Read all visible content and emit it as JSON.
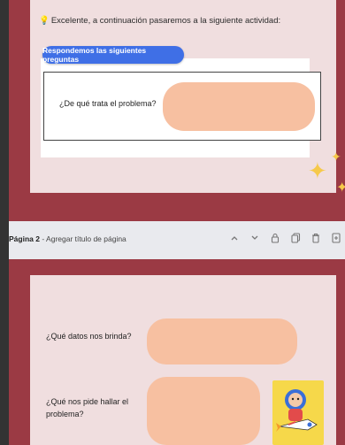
{
  "page1": {
    "intro": "Excelente, a continuación pasaremos a la siguiente actividad:",
    "button_label": "Respondemos las siguientes preguntas",
    "question": "¿De qué trata el problema?"
  },
  "toolbar": {
    "page_number": "Página 2",
    "page_title_placeholder": " - Agregar título de página",
    "icons": [
      "chevron-up-icon",
      "chevron-down-icon",
      "lock-icon",
      "copy-icon",
      "trash-icon",
      "add-page-icon"
    ]
  },
  "page2": {
    "question_1": "¿Qué datos nos brinda?",
    "question_2": "¿Qué nos pide hallar el problema?"
  },
  "colors": {
    "maroon": "#9b3a44",
    "card": "#f0dedf",
    "answer_pill": "#f7c0a1",
    "blue_button": "#3f6fe6",
    "sparkle": "#f6c94a"
  }
}
